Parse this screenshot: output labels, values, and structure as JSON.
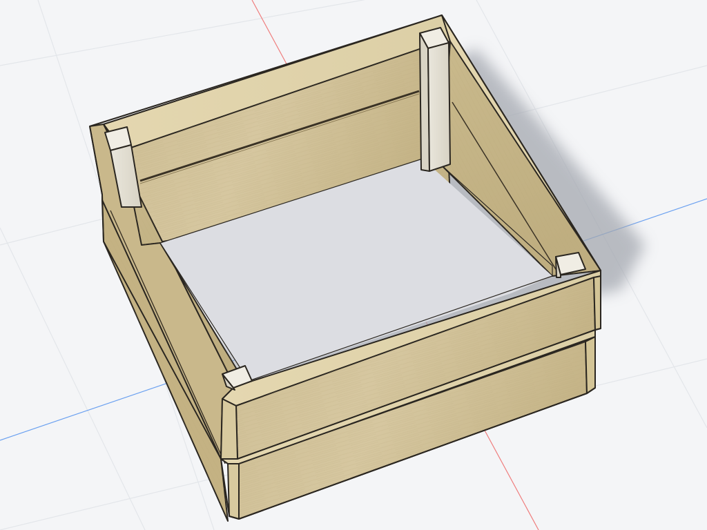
{
  "viewport": {
    "scene": "3d-model-view",
    "background_color": "#f4f5f7",
    "grid_color": "#e2e5ea",
    "axis_x_color": "#6aa0f0",
    "axis_y_color": "#ef7d7d",
    "wood_color": "#cdbd93",
    "wood_edge_color": "#2a2620",
    "post_color": "#e3dfd3",
    "shadow_color": "#9a9ea6"
  },
  "model": {
    "name_icon": "wooden-box-icon",
    "components": [
      "back-panel",
      "left-panel",
      "right-panel",
      "front-panel-upper",
      "front-panel-lower",
      "corner-post"
    ]
  }
}
